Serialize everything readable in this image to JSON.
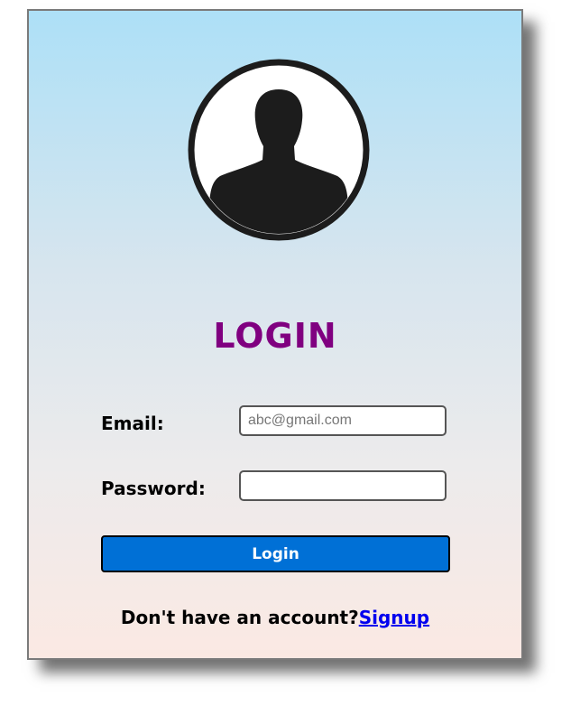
{
  "login_card": {
    "avatar_icon": "user-silhouette-icon",
    "title": "LOGIN",
    "email_label": "Email:",
    "email_placeholder": "abc@gmail.com",
    "email_value": "",
    "password_label": "Password:",
    "password_value": "",
    "login_button_label": "Login",
    "no_account_text": "Don't have an account?",
    "signup_link_label": "Signup"
  },
  "colors": {
    "title": "#800080",
    "button_bg": "#0070d6",
    "link": "#0000ee",
    "gradient_top": "#ade0f7",
    "gradient_bottom": "#fbe9e3"
  }
}
